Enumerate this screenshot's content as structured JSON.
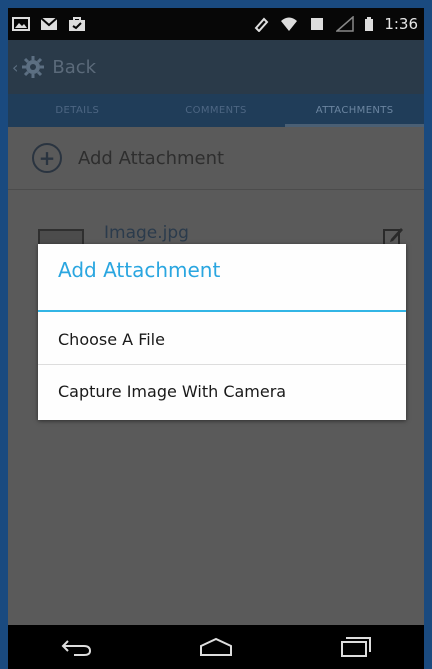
{
  "status_bar": {
    "time": "1:36",
    "icons": [
      "image-icon",
      "gmail-icon",
      "bag-icon",
      "rotate-icon",
      "wifi-icon",
      "signal-icon",
      "battery-icon"
    ]
  },
  "action_bar": {
    "back_label": "Back",
    "app_icon": "gear-icon"
  },
  "tabs": [
    {
      "label": "DETAILS",
      "active": false
    },
    {
      "label": "COMMENTS",
      "active": false
    },
    {
      "label": "ATTACHMENTS",
      "active": true
    }
  ],
  "content": {
    "add_attachment_label": "Add Attachment",
    "attachments": [
      {
        "name": "Image.jpg"
      }
    ]
  },
  "dialog": {
    "title": "Add Attachment",
    "options": [
      "Choose A File",
      "Capture Image With Camera"
    ]
  },
  "nav_bar": {
    "icons": [
      "back-icon",
      "home-icon",
      "recents-icon"
    ]
  },
  "colors": {
    "accent": "#33b5e5",
    "frame": "#1a4a7f",
    "status_bar": "#070707"
  }
}
